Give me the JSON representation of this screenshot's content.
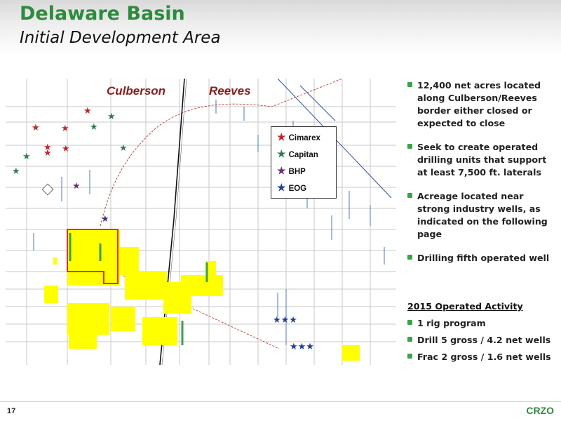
{
  "slide": {
    "title": "Delaware Basin",
    "subtitle": "Initial Development Area",
    "page_number": "17",
    "logo": "CRZO"
  },
  "map": {
    "counties": [
      "Culberson",
      "Reeves"
    ],
    "legend": [
      {
        "label": "Cimarex",
        "color": "#c0262c",
        "icon": "star-icon"
      },
      {
        "label": "Capitan",
        "color": "#2e7d4e",
        "icon": "star-icon"
      },
      {
        "label": "BHP",
        "color": "#6b2f77",
        "icon": "star-icon"
      },
      {
        "label": "EOG",
        "color": "#1f3f9a",
        "icon": "star-icon"
      }
    ],
    "acreage_color": "#ffff00",
    "initial_area_outline_color": "#e53030"
  },
  "bullets": [
    "12,400 net acres located along Culberson/Reeves border either closed or expected to close",
    "Seek to create operated drilling units that support at least 7,500 ft. laterals",
    "Acreage located near strong industry wells, as indicated on the following page",
    "Drilling fifth operated well"
  ],
  "activity": {
    "heading": "2015 Operated Activity",
    "items": [
      "1 rig program",
      "Drill 5 gross / 4.2 net wells",
      "Frac 2 gross / 1.6 net wells"
    ]
  },
  "colors": {
    "title_green": "#2e8b3e",
    "bullet_green": "#3aa24b"
  }
}
